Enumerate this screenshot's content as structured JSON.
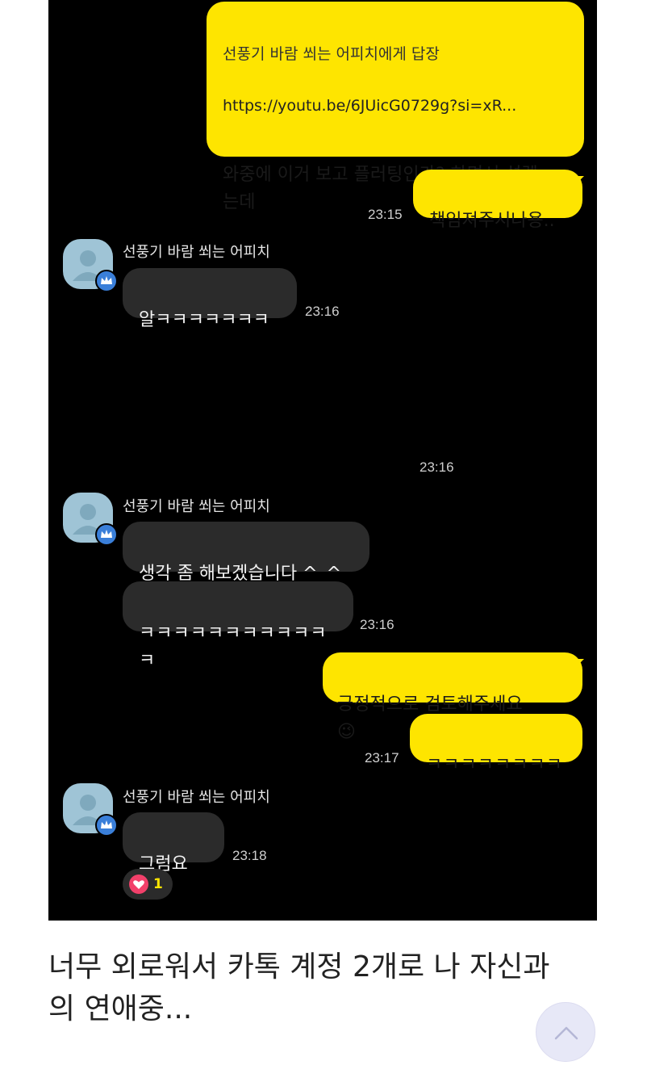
{
  "chat": {
    "reply_quote": {
      "header": "선풍기 바람 쐬는 어피치에게 답장",
      "link": "https://youtu.be/6JUicG0729g?si=xR...",
      "text": "와중에 이거 보고 플러팅인가? 하면서 설렜\n는데"
    },
    "msg_me_1": {
      "text": "책임져주시나용..",
      "time": "23:15"
    },
    "sender_name": "선풍기 바람 쐬는 어피치",
    "msg_them_1": {
      "text": "알ㅋㅋㅋㅋㅋㅋㅋ",
      "time": "23:16"
    },
    "emoji_me": {
      "emoji": "😚",
      "time": "23:16"
    },
    "msg_them_2a": {
      "text": "생각 좀 해보겠습니다 ^_^"
    },
    "msg_them_2b": {
      "text": "ㅋㅋㅋㅋㅋㅋㅋㅋㅋㅋㅋㅋ",
      "time": "23:16"
    },
    "msg_me_3a": {
      "text": "긍정적으로 검토해주세요",
      "emoji": "😉"
    },
    "msg_me_3b": {
      "text": "ㅋㅋㅋㅋㅋㅋㅋㅋ",
      "time": "23:17"
    },
    "msg_them_3": {
      "text": "그럼요 ~",
      "time": "23:18"
    },
    "reaction": {
      "icon": "heart-icon",
      "count": "1"
    }
  },
  "caption": "너무 외로워서 카톡 계정 2개로 나 자신과\n의 연애중...",
  "colors": {
    "my_bubble": "#fee500",
    "their_bubble": "#2b2b2b",
    "chat_bg": "#000000",
    "avatar": "#9fc4d6"
  },
  "icons": {
    "avatar": "person-icon",
    "badge": "crown-icon",
    "scroll_top": "chevron-up-icon"
  }
}
